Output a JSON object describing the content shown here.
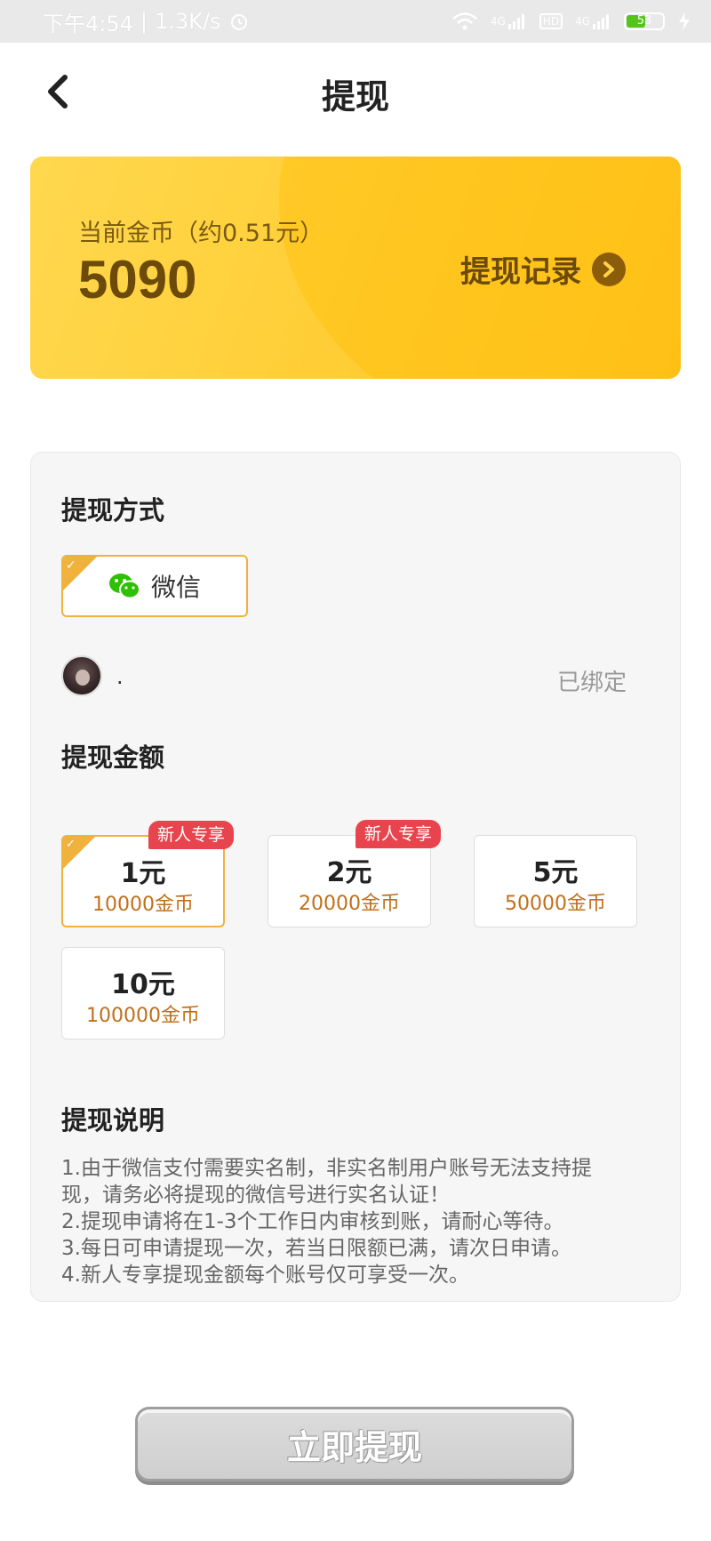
{
  "status_bar": {
    "time": "下午4:54",
    "speed": "1.3K/s",
    "net1": "4G",
    "hd": "HD",
    "net2": "4G",
    "battery": "53"
  },
  "header": {
    "title": "提现"
  },
  "coin_card": {
    "label": "当前金币（约0.51元）",
    "amount": "5090",
    "record_link": "提现记录"
  },
  "method": {
    "title": "提现方式",
    "option": "微信"
  },
  "account": {
    "name": ".",
    "status": "已绑定"
  },
  "amount_section": {
    "title": "提现金额",
    "options": [
      {
        "yuan": "1元",
        "coins": "10000金币",
        "tag": "新人专享",
        "selected": true
      },
      {
        "yuan": "2元",
        "coins": "20000金币",
        "tag": "新人专享",
        "selected": false
      },
      {
        "yuan": "5元",
        "coins": "50000金币",
        "tag": "",
        "selected": false
      },
      {
        "yuan": "10元",
        "coins": "100000金币",
        "tag": "",
        "selected": false
      }
    ]
  },
  "notes": {
    "title": "提现说明",
    "lines": [
      "1.由于微信支付需要实名制，非实名制用户账号无法支持提",
      "现，请务必将提现的微信号进行实名认证！",
      "2.提现申请将在1-3个工作日内审核到账，请耐心等待。",
      "3.每日可申请提现一次，若当日限额已满，请次日申请。",
      "4.新人专享提现金额每个账号仅可享受一次。"
    ]
  },
  "submit": {
    "label": "立即提现"
  },
  "colors": {
    "accent": "#f0b23c",
    "tag": "#e8444e",
    "coin_text": "#c0701a"
  }
}
